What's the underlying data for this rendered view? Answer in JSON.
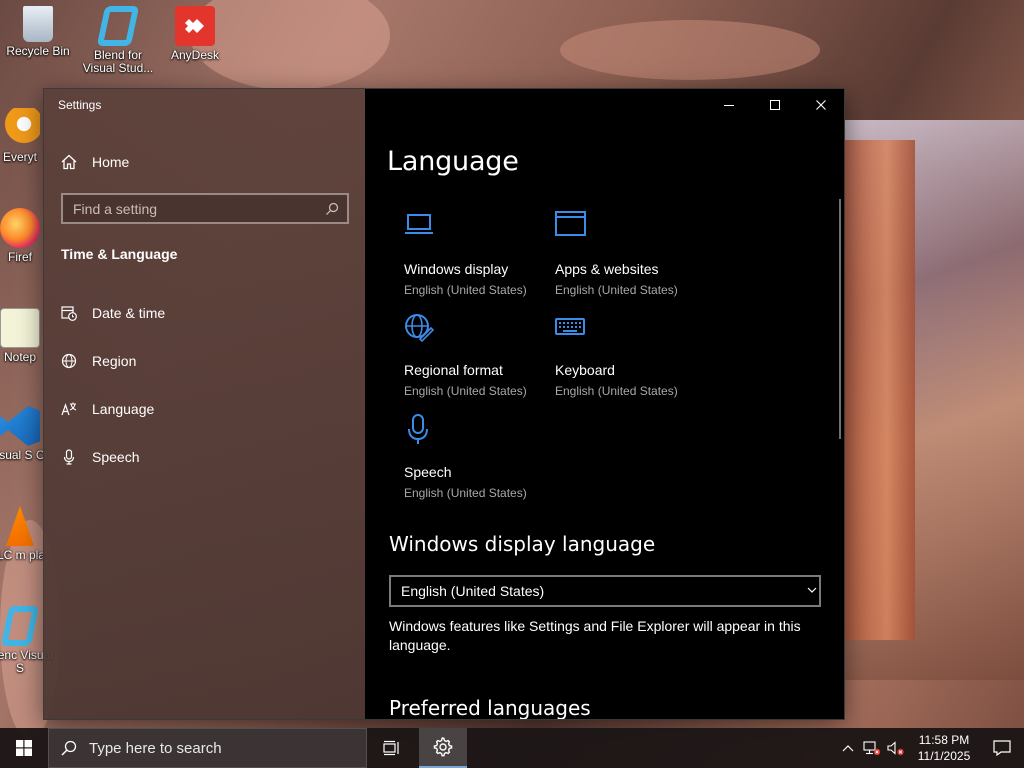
{
  "desktop": {
    "icons": [
      {
        "label": "Recycle Bin"
      },
      {
        "label": "Blend for Visual Stud..."
      },
      {
        "label": "AnyDesk"
      },
      {
        "label": "Everyt"
      },
      {
        "label": "Firef"
      },
      {
        "label": "Notep"
      },
      {
        "label": "Visual S Co"
      },
      {
        "label": "VLC m play"
      },
      {
        "label": "Blenc Visual S"
      }
    ]
  },
  "window": {
    "title": "Settings",
    "controls": {
      "minimize": "minimize",
      "maximize": "maximize",
      "close": "close"
    }
  },
  "sidebar": {
    "home": "Home",
    "search_placeholder": "Find a setting",
    "section": "Time & Language",
    "items": [
      {
        "label": "Date & time",
        "icon": "calendar-clock-icon"
      },
      {
        "label": "Region",
        "icon": "globe-icon"
      },
      {
        "label": "Language",
        "icon": "language-icon"
      },
      {
        "label": "Speech",
        "icon": "microphone-icon"
      }
    ]
  },
  "main": {
    "heading": "Language",
    "tiles": [
      {
        "title": "Windows display",
        "subtitle": "English (United States)",
        "icon": "laptop-icon"
      },
      {
        "title": "Apps & websites",
        "subtitle": "English (United States)",
        "icon": "window-icon"
      },
      {
        "title": "Regional format",
        "subtitle": "English (United States)",
        "icon": "globe-pencil-icon"
      },
      {
        "title": "Keyboard",
        "subtitle": "English (United States)",
        "icon": "keyboard-icon"
      },
      {
        "title": "Speech",
        "subtitle": "English (United States)",
        "icon": "microphone-icon"
      }
    ],
    "display_language": {
      "heading": "Windows display language",
      "selected": "English (United States)",
      "description": "Windows features like Settings and File Explorer will appear in this language."
    },
    "preferred_heading": "Preferred languages"
  },
  "taskbar": {
    "search_placeholder": "Type here to search",
    "time": "11:58 PM",
    "date": "11/1/2025"
  },
  "colors": {
    "accent": "#3c8be8",
    "content_bg": "#000000",
    "sidebar_bg": "#5c403a"
  }
}
